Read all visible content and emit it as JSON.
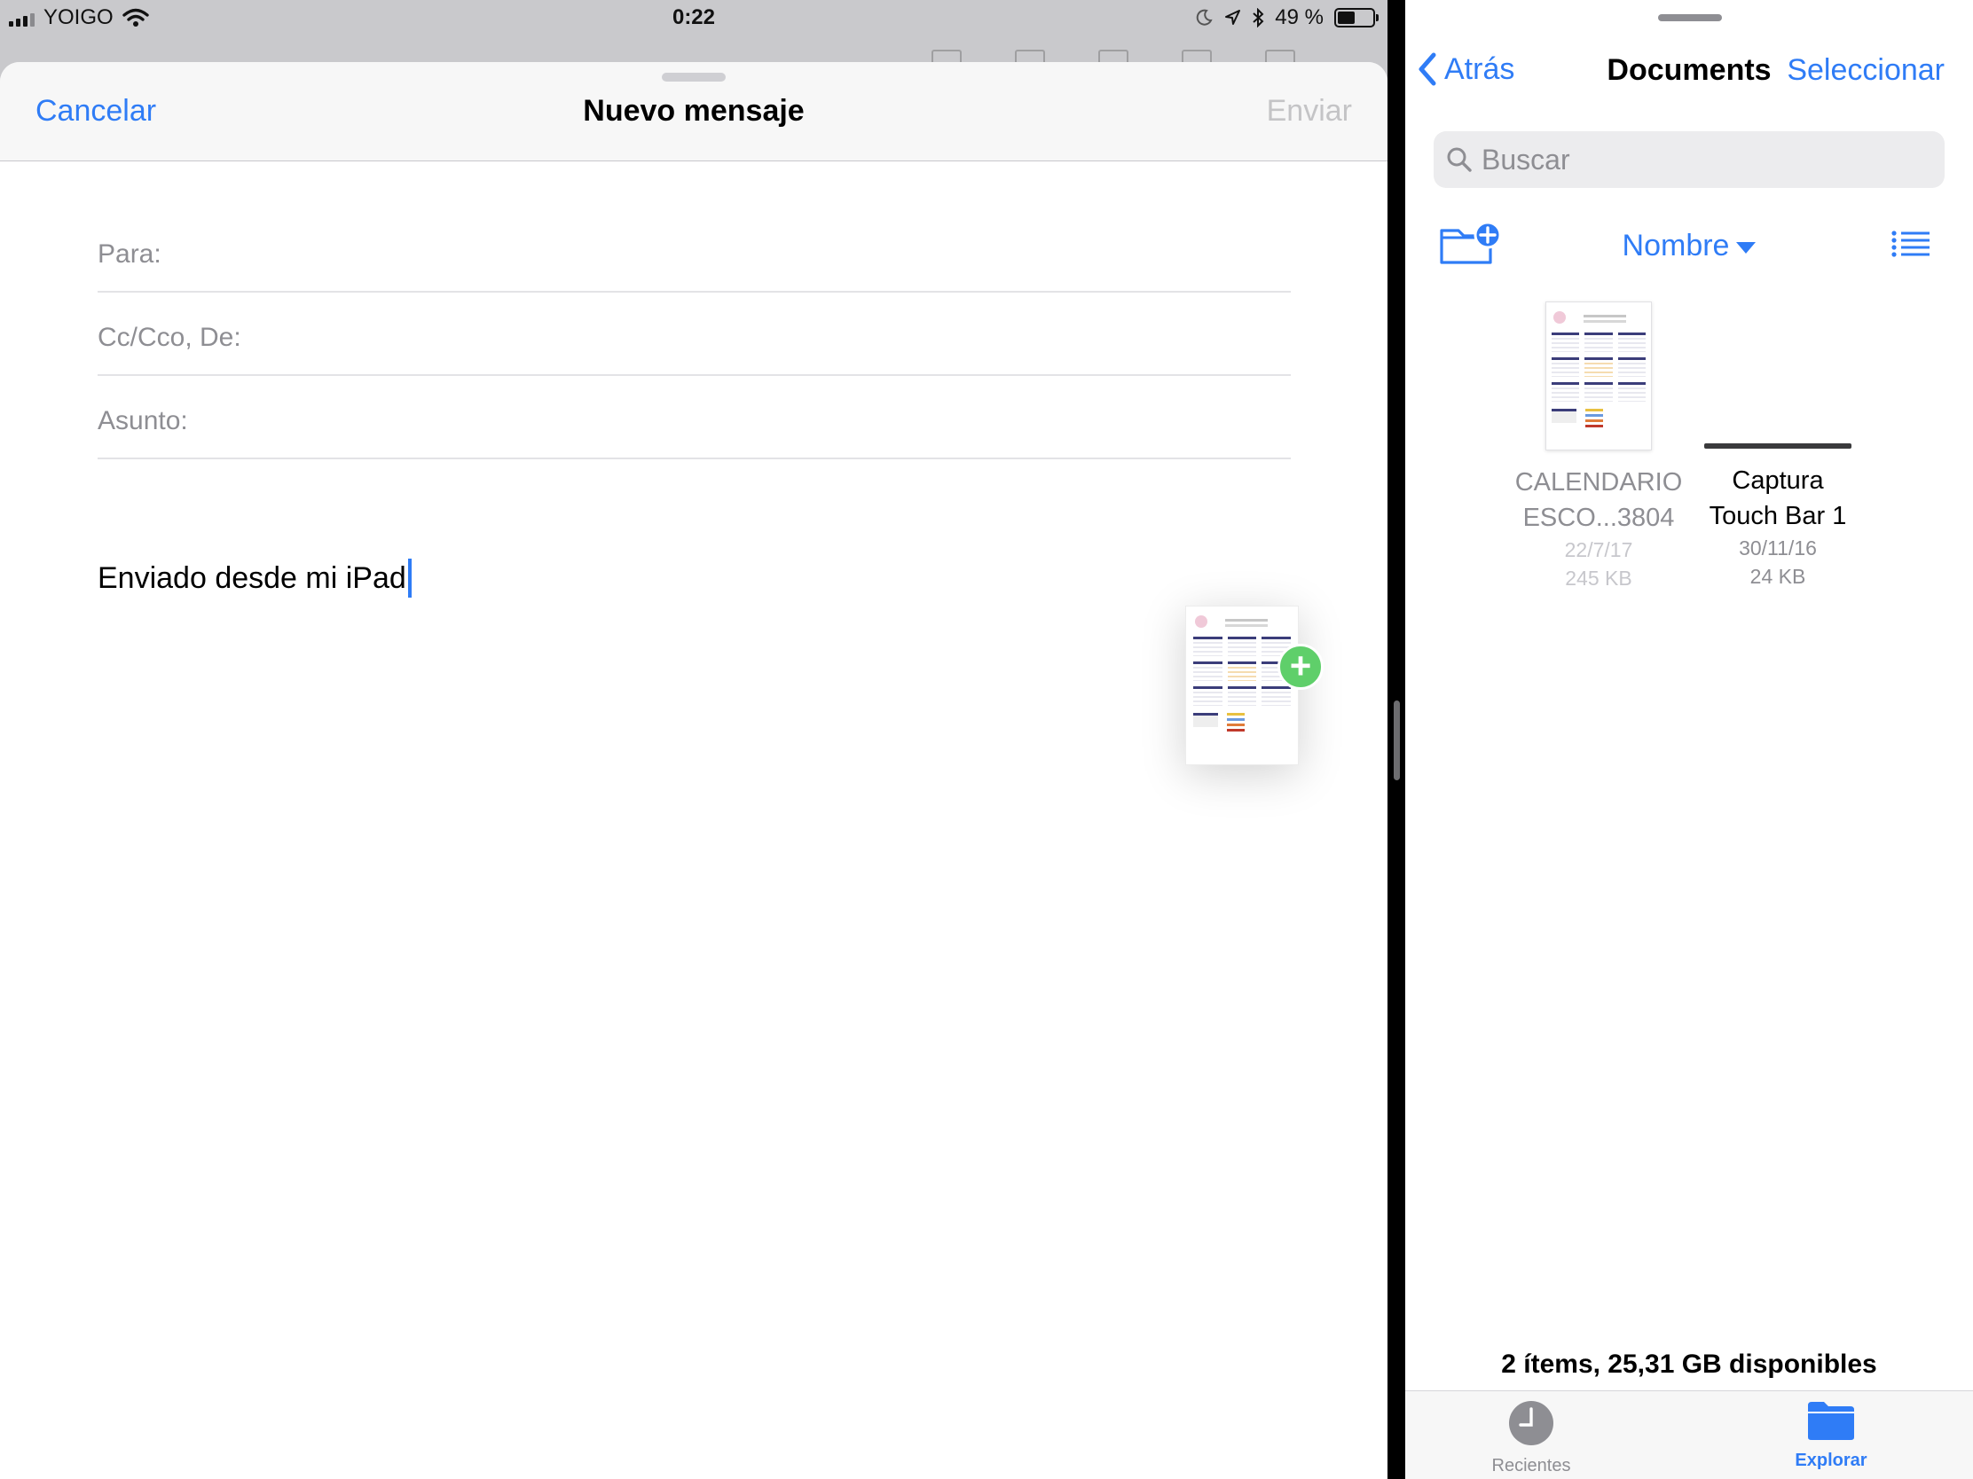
{
  "status_bar": {
    "carrier": "YOIGO",
    "time": "0:22",
    "battery_text": "49 %",
    "battery_level": 0.49
  },
  "mail": {
    "cancel_label": "Cancelar",
    "title": "Nuevo mensaje",
    "send_label": "Enviar",
    "fields": {
      "to_label": "Para:",
      "cc_label": "Cc/Cco, De:",
      "subject_label": "Asunto:"
    },
    "body": "Enviado desde mi iPad",
    "drag_badge": "+"
  },
  "files": {
    "back_label": "Atrás",
    "title": "Documents",
    "select_label": "Seleccionar",
    "search_placeholder": "Buscar",
    "sort_label": "Nombre",
    "items": [
      {
        "name_line1": "CALENDARIO",
        "name_line2": "ESCO...3804",
        "date": "22/7/17",
        "size": "245 KB"
      },
      {
        "name_line1": "Captura",
        "name_line2": "Touch Bar 1",
        "date": "30/11/16",
        "size": "24 KB"
      }
    ],
    "storage": "2 ítems, 25,31 GB disponibles",
    "tabs": [
      {
        "label": "Recientes"
      },
      {
        "label": "Explorar"
      }
    ]
  },
  "colors": {
    "accent": "#2f7cf6",
    "add_badge": "#5fcf6a",
    "calendar_header": "#3b3d7a"
  },
  "icons": [
    "signal-icon",
    "wifi-icon",
    "moon-icon",
    "location-icon",
    "bluetooth-icon",
    "battery-icon",
    "search-icon",
    "new-folder-icon",
    "list-view-icon",
    "clock-icon",
    "folder-icon",
    "chevron-left-icon",
    "add-badge-icon"
  ]
}
